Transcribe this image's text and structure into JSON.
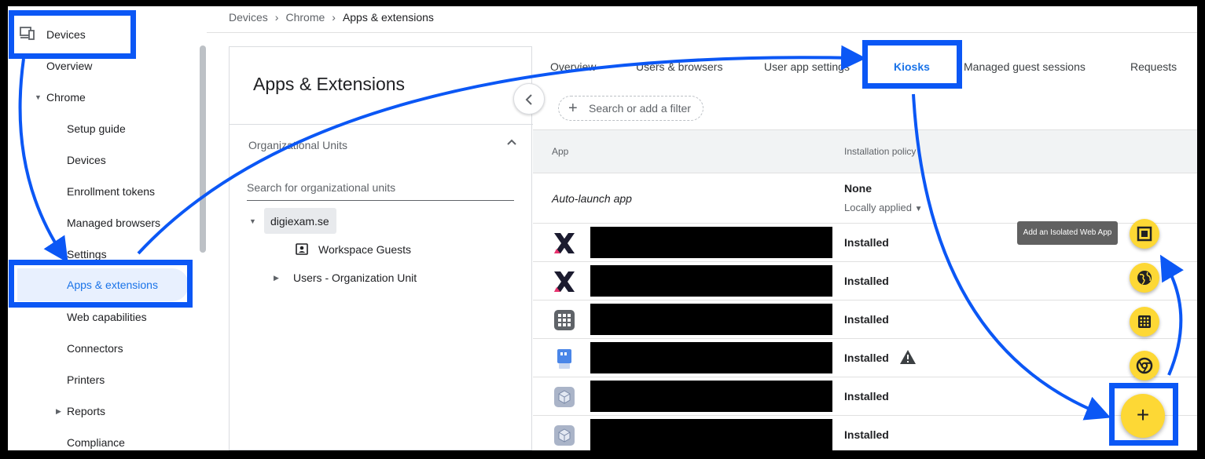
{
  "breadcrumb": {
    "items": [
      "Devices",
      "Chrome",
      "Apps & extensions"
    ]
  },
  "nav": {
    "devices": "Devices",
    "overview": "Overview",
    "chrome": "Chrome",
    "setup_guide": "Setup guide",
    "devices_sub": "Devices",
    "enrollment_tokens": "Enrollment tokens",
    "managed_browsers": "Managed browsers",
    "settings": "Settings",
    "apps_extensions": "Apps & extensions",
    "web_capabilities": "Web capabilities",
    "connectors": "Connectors",
    "printers": "Printers",
    "reports": "Reports",
    "compliance": "Compliance"
  },
  "panel": {
    "title": "Apps & Extensions",
    "ou_label": "Organizational Units",
    "ou_search_placeholder": "Search for organizational units",
    "tree": [
      "digiexam.se",
      "Workspace Guests",
      "Users - Organization Unit"
    ]
  },
  "tabs": [
    "Overview",
    "Users & browsers",
    "User app settings",
    "Kiosks",
    "Managed guest sessions",
    "Requests"
  ],
  "active_tab": "Kiosks",
  "filter": {
    "label": "Search or add a filter"
  },
  "table": {
    "headers": [
      "App",
      "Installation policy"
    ],
    "auto_launch": {
      "label": "Auto-launch app",
      "value": "None",
      "sub": "Locally applied"
    },
    "rows": [
      {
        "icon": "x-logo-icon",
        "status": "Installed"
      },
      {
        "icon": "x-logo-icon",
        "status": "Installed"
      },
      {
        "icon": "grid-app-icon",
        "status": "Installed"
      },
      {
        "icon": "chat-app-icon",
        "status": "Installed",
        "warning": true
      },
      {
        "icon": "cube-app-icon",
        "status": "Installed"
      },
      {
        "icon": "cube-app-icon",
        "status": "Installed"
      }
    ]
  },
  "fab": {
    "tooltip": "Add an Isolated Web App",
    "actions": [
      "isolated-web-app-icon",
      "globe-icon",
      "grid-icon",
      "chrome-icon"
    ],
    "main": "+"
  },
  "colors": {
    "accent": "#1a73e8",
    "annotation": "#0b57f5",
    "fab": "#fdd835"
  }
}
